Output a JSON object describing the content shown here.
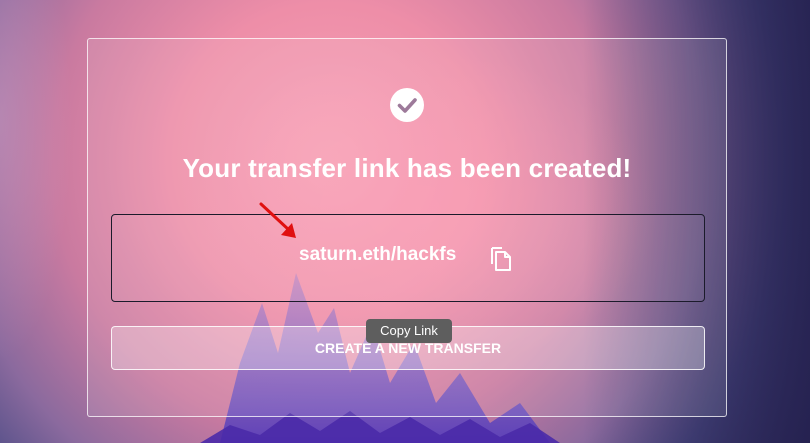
{
  "dialog": {
    "icon": "check-circle-icon",
    "title": "Your transfer link has been created!",
    "link": "saturn.eth/hackfs",
    "copy_icon": "copy-icon",
    "tooltip": "Copy Link",
    "create_button_label": "CREATE A NEW TRANSFER"
  },
  "annotation": {
    "type": "arrow",
    "color": "#e01010"
  },
  "colors": {
    "text": "#ffffff",
    "link_box_border": "#1b1b2b",
    "tooltip_bg": "#5e5e5e"
  }
}
